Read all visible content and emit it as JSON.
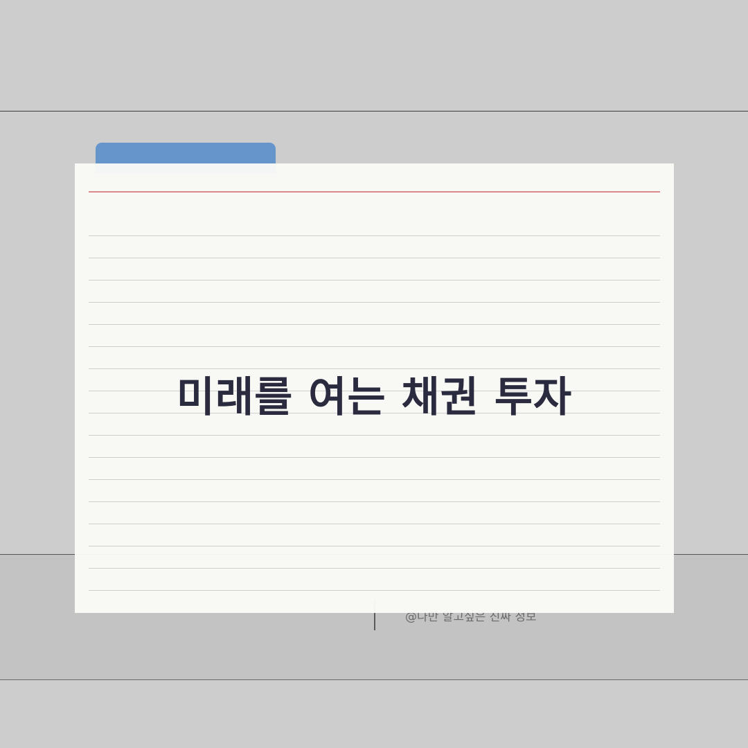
{
  "card": {
    "title": "미래를 여는 채권 투자"
  },
  "footer": {
    "credit": "@나만 알고싶은 진짜 정보"
  }
}
